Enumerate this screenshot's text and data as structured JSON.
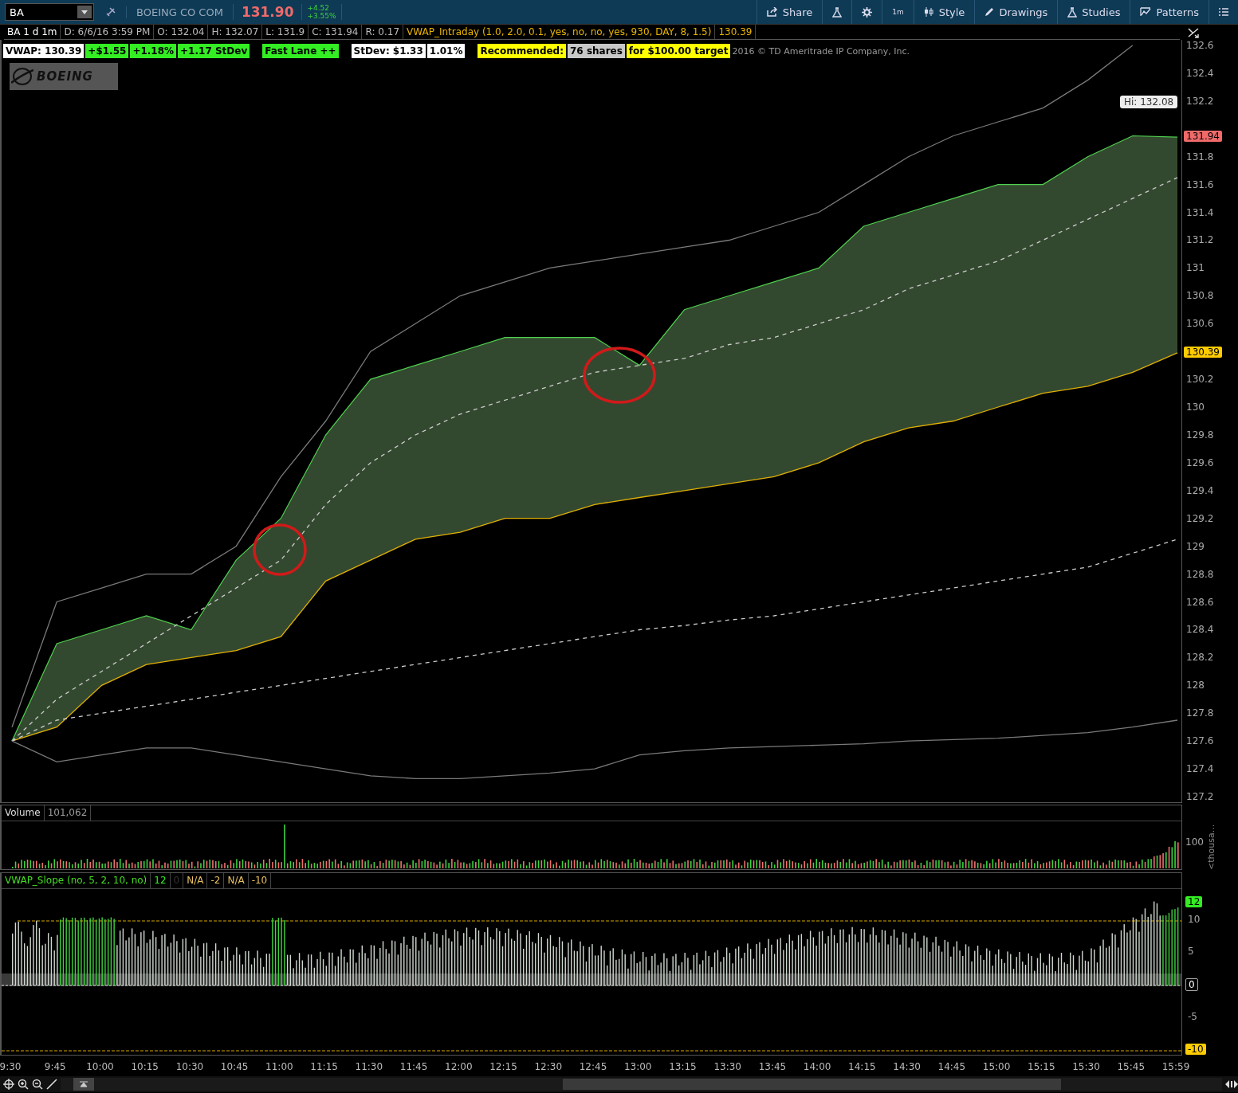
{
  "toolbar": {
    "symbol": "BA",
    "company": "BOEING CO COM",
    "last": "131.90",
    "change": "+4.52",
    "change_pct": "+3.55%",
    "buttons": [
      {
        "kind": "share",
        "label": "Share"
      },
      {
        "kind": "flask"
      },
      {
        "kind": "gear"
      },
      {
        "kind": "text",
        "label": "1m"
      },
      {
        "kind": "style",
        "label": "Style"
      },
      {
        "kind": "pencil",
        "label": "Drawings"
      },
      {
        "kind": "flask",
        "label": "Studies"
      },
      {
        "kind": "patterns",
        "label": "Patterns"
      },
      {
        "kind": "menu"
      }
    ]
  },
  "info_bar": [
    {
      "text": "BA 1 d 1m",
      "color": "#ffffff"
    },
    {
      "text": "D: 6/6/16 3:59 PM",
      "color": "#bbbbbb"
    },
    {
      "text": "O: 132.04",
      "color": "#bbbbbb"
    },
    {
      "text": "H: 132.07",
      "color": "#bbbbbb"
    },
    {
      "text": "L: 131.9",
      "color": "#bbbbbb"
    },
    {
      "text": "C: 131.94",
      "color": "#bbbbbb"
    },
    {
      "text": "R: 0.17",
      "color": "#bbbbbb"
    },
    {
      "text": "VWAP_Intraday (1.0, 2.0, 0.1, yes, no, no, yes, 930, DAY, 8, 1.5)",
      "color": "#e8b400"
    },
    {
      "text": "130.39",
      "color": "#e8b400"
    }
  ],
  "badges": [
    [
      {
        "text": "VWAP: 130.39",
        "color": "#ffffff"
      },
      {
        "text": "+$1.55",
        "color": "#33ee22"
      },
      {
        "text": "+1.18%",
        "color": "#33ee22"
      },
      {
        "text": "+1.17 StDev",
        "color": "#33ee22"
      }
    ],
    [
      {
        "text": "Fast Lane ++",
        "color": "#33ee22"
      }
    ],
    [
      {
        "text": "StDev: $1.33",
        "color": "#ffffff"
      },
      {
        "text": "1.01%",
        "color": "#ffffff"
      }
    ],
    [
      {
        "text": "Recommended:",
        "color": "#ffff00"
      },
      {
        "text": "76 shares",
        "color": "#c8c8c8"
      },
      {
        "text": "for $100.00 target",
        "color": "#ffff00"
      }
    ]
  ],
  "copyright": "2016 © TD Ameritrade IP Company, Inc.",
  "logo": "BOEING",
  "price_tags": {
    "high": "Hi: 132.08",
    "last": "131.94",
    "vwap": "130.39"
  },
  "time_axis": [
    "9:30",
    "9:45",
    "10:00",
    "10:15",
    "10:30",
    "10:45",
    "11:00",
    "11:15",
    "11:30",
    "11:45",
    "12:00",
    "12:15",
    "12:30",
    "12:45",
    "13:00",
    "13:15",
    "13:30",
    "13:45",
    "14:00",
    "14:15",
    "14:30",
    "14:45",
    "15:00",
    "15:15",
    "15:30",
    "15:45",
    "15:59"
  ],
  "chart_data": {
    "type": "line",
    "ylim": [
      127.16,
      132.64
    ],
    "yticks": [
      127.2,
      127.4,
      127.6,
      127.8,
      128,
      128.2,
      128.4,
      128.6,
      128.8,
      129,
      129.2,
      129.4,
      129.6,
      129.8,
      130,
      130.2,
      130.6,
      130.8,
      131,
      131.2,
      131.4,
      131.6,
      131.8,
      132.2,
      132.4,
      132.6
    ],
    "series": [
      {
        "color": "#4fd14f",
        "values": [
          127.6,
          128.3,
          128.4,
          128.5,
          128.4,
          128.9,
          129.2,
          129.8,
          130.2,
          130.3,
          130.4,
          130.5,
          130.5,
          130.5,
          130.3,
          130.7,
          130.8,
          130.9,
          131.0,
          131.3,
          131.4,
          131.5,
          131.6,
          131.6,
          131.8,
          131.95,
          131.94
        ]
      },
      {
        "color": "#cccccc",
        "line_style": "dashed",
        "values": [
          127.6,
          127.9,
          128.1,
          128.3,
          128.5,
          128.7,
          128.9,
          129.3,
          129.6,
          129.8,
          129.95,
          130.05,
          130.15,
          130.25,
          130.3,
          130.35,
          130.45,
          130.5,
          130.6,
          130.7,
          130.85,
          130.95,
          131.05,
          131.2,
          131.35,
          131.5,
          131.65
        ]
      },
      {
        "color": "#7a7a7a",
        "values": [
          127.7,
          128.6,
          128.7,
          128.8,
          128.8,
          129.0,
          129.5,
          129.9,
          130.4,
          130.6,
          130.8,
          130.9,
          131.0,
          131.05,
          131.1,
          131.15,
          131.2,
          131.3,
          131.4,
          131.6,
          131.8,
          131.95,
          132.05,
          132.15,
          132.35,
          132.6,
          null
        ]
      },
      {
        "color": "#e0b000",
        "values": [
          127.6,
          127.7,
          128.0,
          128.15,
          128.2,
          128.25,
          128.35,
          128.75,
          128.9,
          129.05,
          129.1,
          129.2,
          129.2,
          129.3,
          129.35,
          129.4,
          129.45,
          129.5,
          129.6,
          129.75,
          129.85,
          129.9,
          130.0,
          130.1,
          130.15,
          130.25,
          130.39
        ]
      },
      {
        "color": "#cccccd",
        "line_style": "dashed",
        "values": [
          127.6,
          127.75,
          127.8,
          127.85,
          127.9,
          127.95,
          128.0,
          128.05,
          128.1,
          128.15,
          128.2,
          128.25,
          128.3,
          128.35,
          128.4,
          128.43,
          128.47,
          128.5,
          128.55,
          128.6,
          128.65,
          128.7,
          128.75,
          128.8,
          128.85,
          128.95,
          129.05
        ]
      },
      {
        "color": "#7a7a7b",
        "values": [
          127.6,
          127.45,
          127.5,
          127.55,
          127.55,
          127.5,
          127.45,
          127.4,
          127.35,
          127.33,
          127.33,
          127.35,
          127.37,
          127.4,
          127.5,
          127.53,
          127.55,
          127.56,
          127.57,
          127.58,
          127.6,
          127.61,
          127.62,
          127.64,
          127.66,
          127.7,
          127.75
        ]
      }
    ]
  },
  "volume": {
    "title": "Volume",
    "value": "101,062",
    "tick": "100",
    "unit": "<thousa..."
  },
  "slope": {
    "title": "VWAP_Slope (no, 5, 2, 10, no)",
    "readings": [
      {
        "text": "12",
        "color": "#33ee22"
      },
      {
        "text": "0",
        "color": "#333333"
      },
      {
        "text": "N/A",
        "color": "#e8c060"
      },
      {
        "text": "-2",
        "color": "#e8c060"
      },
      {
        "text": "N/A",
        "color": "#e8c060"
      },
      {
        "text": "-10",
        "color": "#e8c060"
      }
    ],
    "ticks": [
      {
        "text": "12",
        "kind": "green"
      },
      {
        "text": "10",
        "kind": "plain"
      },
      {
        "text": "5",
        "kind": "plain"
      },
      {
        "text": "0",
        "kind": "boxed"
      },
      {
        "text": "-5",
        "kind": "plain"
      },
      {
        "text": "-10",
        "kind": "yellow"
      }
    ]
  }
}
